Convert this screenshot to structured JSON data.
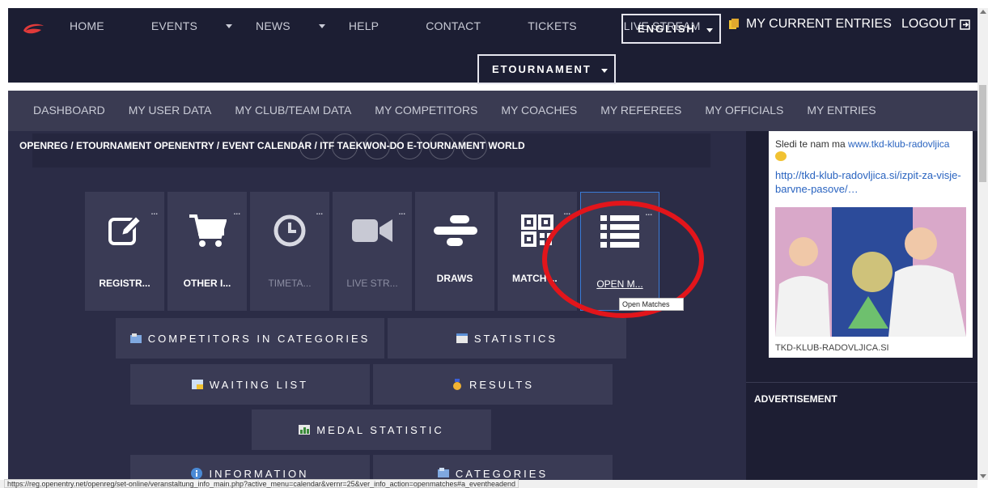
{
  "topnav": {
    "items": [
      "HOME",
      "EVENTS",
      "NEWS",
      "HELP",
      "CONTACT",
      "TICKETS",
      "LIVE STREAM"
    ],
    "language": "ENGLISH",
    "my_entries": "MY CURRENT ENTRIES",
    "logout": "LOGOUT",
    "tournament": "ETOURNAMENT"
  },
  "subnav": {
    "items": [
      "DASHBOARD",
      "MY USER DATA",
      "MY CLUB/TEAM DATA",
      "MY COMPETITORS",
      "MY COACHES",
      "MY REFEREES",
      "MY OFFICIALS",
      "MY ENTRIES"
    ]
  },
  "breadcrumb": "OPENREG / ETOURNAMENT OPENENTRY / EVENT CALENDAR / ITF TAEKWON-DO E-TOURNAMENT WORLD",
  "tiles": [
    {
      "label": "REGISTR...",
      "icon": "edit-icon",
      "dots": "..."
    },
    {
      "label": "OTHER I...",
      "icon": "cart-icon",
      "dots": "..."
    },
    {
      "label": "TIMETA...",
      "icon": "clock-icon",
      "dots": "..."
    },
    {
      "label": "LIVE STR...",
      "icon": "video-icon",
      "dots": "..."
    },
    {
      "label": "DRAWS",
      "icon": "draws-icon",
      "dots": ""
    },
    {
      "label": "MATCH ...",
      "icon": "qr-icon",
      "dots": "..."
    },
    {
      "label": "OPEN M...",
      "icon": "list-icon",
      "dots": "..."
    }
  ],
  "buttons": {
    "competitors": "COMPETITORS IN CATEGORIES",
    "statistics": "STATISTICS",
    "waiting": "WAITING LIST",
    "results": "RESULTS",
    "medal": "MEDAL STATISTIC",
    "information": "INFORMATION",
    "categories": "CATEGORIES"
  },
  "tooltip": "Open Matches",
  "sidebar": {
    "follow_text": "Sledi te nam ma ",
    "follow_link": "www.tkd-klub-radovljica",
    "post_link": "http://tkd-klub-radovljica.si/izpit-za-visje-barvne-pasove/…",
    "site_name": "TKD-KLUB-RADOVLJICA.SI",
    "advertisement": "ADVERTISEMENT"
  },
  "status_url": "https://reg.openentry.net/openreg/set-online/veranstaltung_info_main.php?active_menu=calendar&vernr=25&ver_info_action=openmatches#a_eventheadend",
  "colors": {
    "nav_bg": "#1c1e33",
    "subnav_bg": "#3a3b52",
    "main_bg": "#2b2c46",
    "tile_bg": "#3a3b55",
    "highlight_ellipse": "#e2151b",
    "active_border": "#3b7bd6"
  }
}
